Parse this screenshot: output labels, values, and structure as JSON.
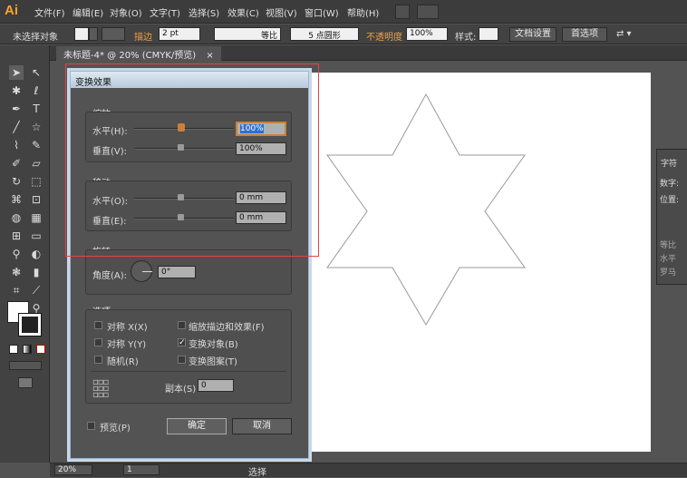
{
  "app": {
    "logo": "Ai"
  },
  "menu": [
    "文件(F)",
    "编辑(E)",
    "对象(O)",
    "文字(T)",
    "选择(S)",
    "效果(C)",
    "视图(V)",
    "窗口(W)",
    "帮助(H)"
  ],
  "control_bar": {
    "selection": "未选择对象",
    "stroke_label": "描边",
    "stroke_weight": "2 pt",
    "stroke_profile": "等比",
    "brush": "5 点圆形",
    "opacity_label": "不透明度",
    "opacity": "100%",
    "style_label": "样式:",
    "doc_setup": "文档设置",
    "prefs": "首选项"
  },
  "tab": {
    "title": "未标题-4* @ 20% (CMYK/预览)",
    "close": "×"
  },
  "dialog": {
    "title": "变换效果",
    "scale": {
      "title": "缩放",
      "h_label": "水平(H):",
      "h_value": "100%",
      "v_label": "垂直(V):",
      "v_value": "100%"
    },
    "move": {
      "title": "移动",
      "h_label": "水平(O):",
      "h_value": "0 mm",
      "v_label": "垂直(E):",
      "v_value": "0 mm"
    },
    "rotate": {
      "title": "旋转",
      "angle_label": "角度(A):",
      "angle_value": "0°"
    },
    "options": {
      "title": "选项",
      "reflect_x": "对称 X(X)",
      "reflect_y": "对称 Y(Y)",
      "random": "随机(R)",
      "scale_strokes": "缩放描边和效果(F)",
      "transform_objects": "变换对象(B)",
      "transform_patterns": "变换图案(T)",
      "copies_label": "副本(S)",
      "copies_value": "0"
    },
    "preview": "预览(P)",
    "ok": "确定",
    "cancel": "取消"
  },
  "char_panel": {
    "tab": "字符",
    "row1": "数字:",
    "row2": "位置:",
    "row3": "等比",
    "row4": "水平",
    "row5": "罗马"
  },
  "status": {
    "zoom": "20%",
    "page": "1",
    "mode": "选择"
  }
}
